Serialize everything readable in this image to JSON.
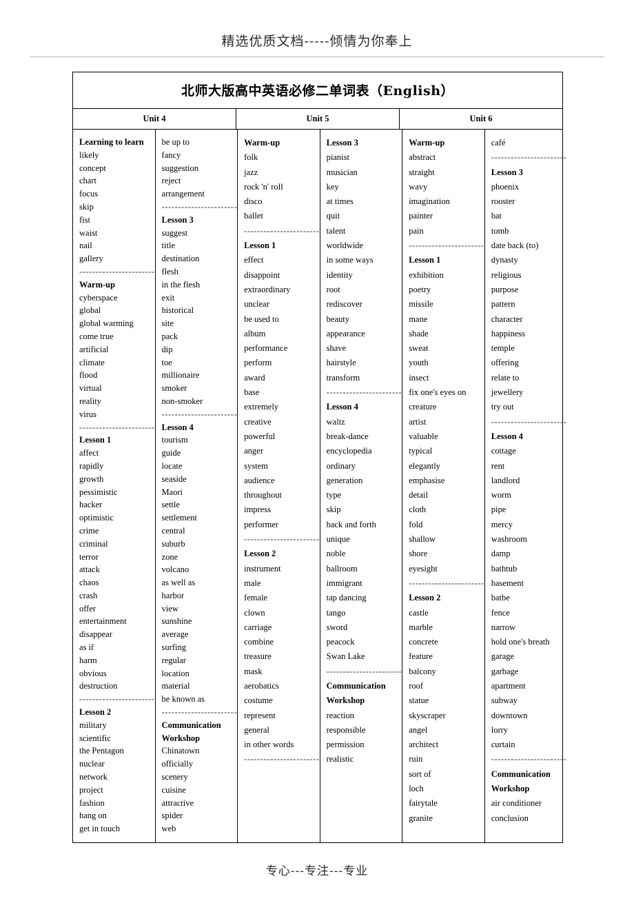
{
  "header": {
    "watermark": "精选优质文档-----倾情为你奉上"
  },
  "footer": {
    "watermark": "专心---专注---专业"
  },
  "table": {
    "title": "北师大版高中英语必修二单词表（English）",
    "units": [
      {
        "label": "Unit 4"
      },
      {
        "label": "Unit 5"
      },
      {
        "label": "Unit 6"
      }
    ],
    "separator": "-----------------------",
    "columns": [
      {
        "id": "unit4-col1",
        "spacing": "tight",
        "entries": [
          {
            "text": "Learning to learn",
            "head": true
          },
          {
            "text": "likely"
          },
          {
            "text": "concept"
          },
          {
            "text": "chart"
          },
          {
            "text": "focus"
          },
          {
            "text": "skip"
          },
          {
            "text": "fist"
          },
          {
            "text": "waist"
          },
          {
            "text": "nail"
          },
          {
            "text": "gallery"
          },
          {
            "sep": true
          },
          {
            "text": "Warm-up",
            "head": true
          },
          {
            "text": "cyberspace"
          },
          {
            "text": "global"
          },
          {
            "text": "global warming"
          },
          {
            "text": "come true"
          },
          {
            "text": "artificial"
          },
          {
            "text": "climate"
          },
          {
            "text": "flood"
          },
          {
            "text": "virtual"
          },
          {
            "text": "reality"
          },
          {
            "text": "virus"
          },
          {
            "sep": true
          },
          {
            "text": "Lesson 1",
            "head": true
          },
          {
            "text": "affect"
          },
          {
            "text": "rapidly"
          },
          {
            "text": "growth"
          },
          {
            "text": "pessimistic"
          },
          {
            "text": "hacker"
          },
          {
            "text": "optimistic"
          },
          {
            "text": "crime"
          },
          {
            "text": "criminal"
          },
          {
            "text": "terror"
          },
          {
            "text": "attack"
          },
          {
            "text": "chaos"
          },
          {
            "text": "crash"
          },
          {
            "text": "offer"
          },
          {
            "text": "entertainment"
          },
          {
            "text": "disappear"
          },
          {
            "text": "as if"
          },
          {
            "text": "harm"
          },
          {
            "text": "obvious"
          },
          {
            "text": "destruction"
          },
          {
            "sep": true
          },
          {
            "text": "Lesson 2",
            "head": true
          },
          {
            "text": "military"
          },
          {
            "text": "scientific"
          },
          {
            "text": "the Pentagon"
          },
          {
            "text": "nuclear"
          },
          {
            "text": "network"
          },
          {
            "text": "project"
          },
          {
            "text": "fashion"
          },
          {
            "text": "hang on"
          },
          {
            "text": "get in touch"
          }
        ]
      },
      {
        "id": "unit4-col2",
        "spacing": "tight",
        "entries": [
          {
            "text": "be up to"
          },
          {
            "text": "fancy"
          },
          {
            "text": "suggestion"
          },
          {
            "text": "reject"
          },
          {
            "text": "arrangement"
          },
          {
            "sep": true
          },
          {
            "text": "Lesson 3",
            "head": true
          },
          {
            "text": "suggest"
          },
          {
            "text": "title"
          },
          {
            "text": "destination"
          },
          {
            "text": "flesh"
          },
          {
            "text": "in the flesh"
          },
          {
            "text": "exit"
          },
          {
            "text": "historical"
          },
          {
            "text": "site"
          },
          {
            "text": "pack"
          },
          {
            "text": "dip"
          },
          {
            "text": "toe"
          },
          {
            "text": "millionaire"
          },
          {
            "text": "smoker"
          },
          {
            "text": "non-smoker"
          },
          {
            "sep": true
          },
          {
            "text": "Lesson 4",
            "head": true
          },
          {
            "text": "tourism"
          },
          {
            "text": "guide"
          },
          {
            "text": "locate"
          },
          {
            "text": "seaside"
          },
          {
            "text": "Maori"
          },
          {
            "text": "settle"
          },
          {
            "text": "settlement"
          },
          {
            "text": "central"
          },
          {
            "text": "suburb"
          },
          {
            "text": "zone"
          },
          {
            "text": "volcano"
          },
          {
            "text": "as well as"
          },
          {
            "text": "harbor"
          },
          {
            "text": "view"
          },
          {
            "text": "sunshine"
          },
          {
            "text": "average"
          },
          {
            "text": "surfing"
          },
          {
            "text": "regular"
          },
          {
            "text": "location"
          },
          {
            "text": "material"
          },
          {
            "text": "be known as"
          },
          {
            "sep": true
          },
          {
            "text": "Communication",
            "head": true
          },
          {
            "text": "Workshop",
            "head": true
          },
          {
            "text": "Chinatown"
          },
          {
            "text": "officially"
          },
          {
            "text": "scenery"
          },
          {
            "text": "cuisine"
          },
          {
            "text": "attractive"
          },
          {
            "text": "spider"
          },
          {
            "text": "web"
          }
        ]
      },
      {
        "id": "unit5-col1",
        "spacing": "loose",
        "entries": [
          {
            "text": "Warm-up",
            "head": true
          },
          {
            "text": "folk"
          },
          {
            "text": "jazz"
          },
          {
            "text": "rock 'n' roll"
          },
          {
            "text": "disco"
          },
          {
            "text": "ballet"
          },
          {
            "sep": true
          },
          {
            "text": "Lesson 1",
            "head": true
          },
          {
            "text": "effect"
          },
          {
            "text": "disappoint"
          },
          {
            "text": "extraordinary"
          },
          {
            "text": "unclear"
          },
          {
            "text": "be used to"
          },
          {
            "text": "album"
          },
          {
            "text": "performance"
          },
          {
            "text": "perform"
          },
          {
            "text": "award"
          },
          {
            "text": "base"
          },
          {
            "text": "extremely"
          },
          {
            "text": "creative"
          },
          {
            "text": "powerful"
          },
          {
            "text": "anger"
          },
          {
            "text": "system"
          },
          {
            "text": "audience"
          },
          {
            "text": "throughout"
          },
          {
            "text": "impress"
          },
          {
            "text": "performer"
          },
          {
            "sep": true
          },
          {
            "text": "Lesson 2",
            "head": true
          },
          {
            "text": "instrument"
          },
          {
            "text": "male"
          },
          {
            "text": "female"
          },
          {
            "text": "clown"
          },
          {
            "text": "carriage"
          },
          {
            "text": "combine"
          },
          {
            "text": "treasure"
          },
          {
            "text": "mask"
          },
          {
            "text": "aerobatics"
          },
          {
            "text": "costume"
          },
          {
            "text": "represent"
          },
          {
            "text": "general"
          },
          {
            "text": "in other words"
          },
          {
            "sep": true
          }
        ]
      },
      {
        "id": "unit5-col2",
        "spacing": "loose",
        "entries": [
          {
            "text": "Lesson 3",
            "head": true
          },
          {
            "text": "pianist"
          },
          {
            "text": "musician"
          },
          {
            "text": "key"
          },
          {
            "text": "at times"
          },
          {
            "text": "quit"
          },
          {
            "text": "talent"
          },
          {
            "text": "worldwide"
          },
          {
            "text": "in some ways"
          },
          {
            "text": "identity"
          },
          {
            "text": "root"
          },
          {
            "text": "rediscover"
          },
          {
            "text": "beauty"
          },
          {
            "text": "appearance"
          },
          {
            "text": "shave"
          },
          {
            "text": "hairstyle"
          },
          {
            "text": "transform"
          },
          {
            "sep": true
          },
          {
            "text": "Lesson 4",
            "head": true
          },
          {
            "text": "waltz"
          },
          {
            "text": "break-dance"
          },
          {
            "text": "encyclopedia"
          },
          {
            "text": "ordinary"
          },
          {
            "text": "generation"
          },
          {
            "text": "type"
          },
          {
            "text": "skip"
          },
          {
            "text": "back and forth"
          },
          {
            "text": "unique"
          },
          {
            "text": "noble"
          },
          {
            "text": "ballroom"
          },
          {
            "text": "immigrant"
          },
          {
            "text": "tap dancing"
          },
          {
            "text": "tango"
          },
          {
            "text": "sword"
          },
          {
            "text": "peacock"
          },
          {
            "text": "Swan Lake"
          },
          {
            "sep": true
          },
          {
            "text": "Communication",
            "head": true
          },
          {
            "text": "Workshop",
            "head": true
          },
          {
            "text": "reaction"
          },
          {
            "text": "responsible"
          },
          {
            "text": "permission"
          },
          {
            "text": "realistic"
          }
        ]
      },
      {
        "id": "unit6-col1",
        "spacing": "loose",
        "entries": [
          {
            "text": "Warm-up",
            "head": true
          },
          {
            "text": "abstract"
          },
          {
            "text": "straight"
          },
          {
            "text": "wavy"
          },
          {
            "text": "imagination"
          },
          {
            "text": "painter"
          },
          {
            "text": "pain"
          },
          {
            "sep": true
          },
          {
            "text": "Lesson 1",
            "head": true
          },
          {
            "text": "exhibition"
          },
          {
            "text": "poetry"
          },
          {
            "text": "missile"
          },
          {
            "text": "mane"
          },
          {
            "text": "shade"
          },
          {
            "text": "sweat"
          },
          {
            "text": "youth"
          },
          {
            "text": "insect"
          },
          {
            "text": "fix one's eyes on"
          },
          {
            "text": "creature"
          },
          {
            "text": "artist"
          },
          {
            "text": "valuable"
          },
          {
            "text": "typical"
          },
          {
            "text": "elegantly"
          },
          {
            "text": "emphasise"
          },
          {
            "text": "detail"
          },
          {
            "text": "cloth"
          },
          {
            "text": "fold"
          },
          {
            "text": "shallow"
          },
          {
            "text": "shore"
          },
          {
            "text": "eyesight"
          },
          {
            "sep": true
          },
          {
            "text": "Lesson 2",
            "head": true
          },
          {
            "text": "castle"
          },
          {
            "text": "marble"
          },
          {
            "text": "concrete"
          },
          {
            "text": "feature"
          },
          {
            "text": "balcony"
          },
          {
            "text": "roof"
          },
          {
            "text": "statue"
          },
          {
            "text": "skyscraper"
          },
          {
            "text": "angel"
          },
          {
            "text": "architect"
          },
          {
            "text": "ruin"
          },
          {
            "text": "sort of"
          },
          {
            "text": "loch"
          },
          {
            "text": "fairytale"
          },
          {
            "text": "granite"
          }
        ]
      },
      {
        "id": "unit6-col2",
        "spacing": "loose",
        "entries": [
          {
            "text": "café"
          },
          {
            "sep": true
          },
          {
            "text": "Lesson 3",
            "head": true
          },
          {
            "text": "phoenix"
          },
          {
            "text": "rooster"
          },
          {
            "text": "bat"
          },
          {
            "text": "tomb"
          },
          {
            "text": "date back (to)"
          },
          {
            "text": "dynasty"
          },
          {
            "text": "religious"
          },
          {
            "text": "purpose"
          },
          {
            "text": "pattern"
          },
          {
            "text": "character"
          },
          {
            "text": "happiness"
          },
          {
            "text": "temple"
          },
          {
            "text": "offering"
          },
          {
            "text": "relate to"
          },
          {
            "text": "jewellery"
          },
          {
            "text": "try out"
          },
          {
            "sep": true
          },
          {
            "text": "Lesson 4",
            "head": true
          },
          {
            "text": "cottage"
          },
          {
            "text": "rent"
          },
          {
            "text": "landlord"
          },
          {
            "text": "worm"
          },
          {
            "text": "pipe"
          },
          {
            "text": "mercy"
          },
          {
            "text": "washroom"
          },
          {
            "text": "damp"
          },
          {
            "text": "bathtub"
          },
          {
            "text": "basement"
          },
          {
            "text": "batbe"
          },
          {
            "text": "fence"
          },
          {
            "text": "narrow"
          },
          {
            "text": "hold one's breath"
          },
          {
            "text": "garage"
          },
          {
            "text": "garbage"
          },
          {
            "text": "apartment"
          },
          {
            "text": "subway"
          },
          {
            "text": "downtown"
          },
          {
            "text": "lorry"
          },
          {
            "text": "curtain"
          },
          {
            "sep": true
          },
          {
            "text": "Communication",
            "head": true
          },
          {
            "text": "Workshop",
            "head": true
          },
          {
            "text": "air conditioner"
          },
          {
            "text": "conclusion"
          }
        ]
      }
    ]
  }
}
